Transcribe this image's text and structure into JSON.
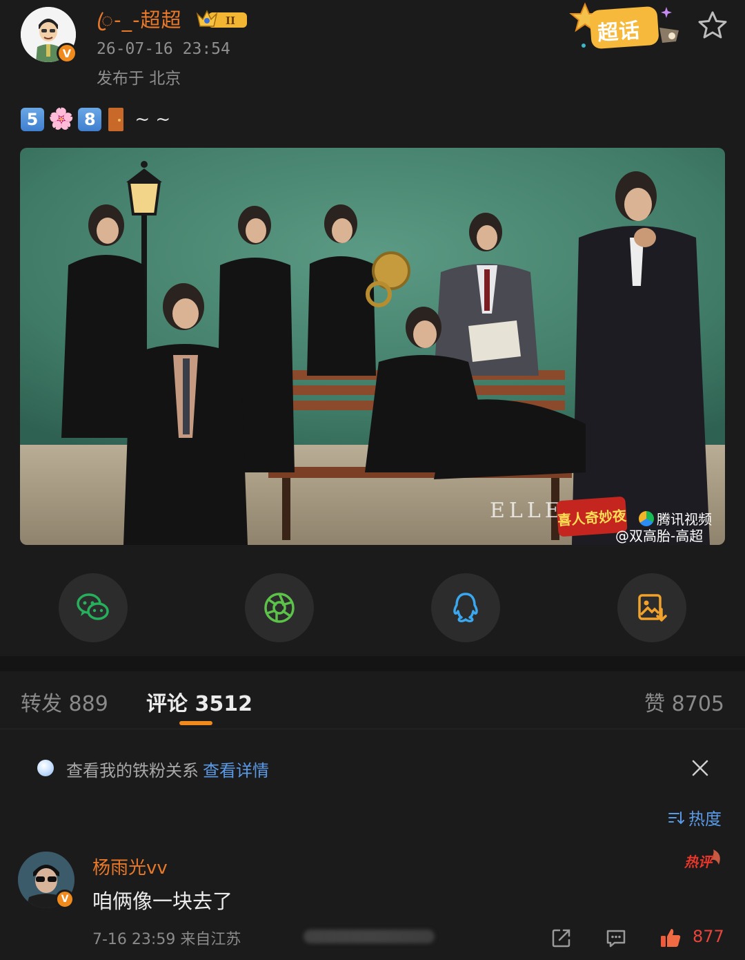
{
  "post": {
    "username": "ꦿ-_-超超",
    "timestamp": "26-07-16 23:54",
    "location": "发布于 北京",
    "level_badge": "II",
    "supertopic_label": "超话",
    "text_keycap_1": "5",
    "text_keycap_2": "8",
    "text_suffix": "~ ~",
    "photo_watermark_magazine": "ELLE",
    "photo_watermark_show": "喜人奇妙夜",
    "photo_watermark_platform": "腾讯视频",
    "photo_watermark_credit": "@双高胎-高超"
  },
  "share": {
    "items": [
      {
        "icon": "wechat-icon"
      },
      {
        "icon": "moments-icon"
      },
      {
        "icon": "qq-icon"
      },
      {
        "icon": "save-image-icon"
      }
    ]
  },
  "tabs": {
    "repost": "转发 889",
    "comment": "评论 3512",
    "like": "赞 8705"
  },
  "fan_banner": {
    "text": "查看我的铁粉关系",
    "link": "查看详情"
  },
  "sort": {
    "label": "热度"
  },
  "comment": {
    "author": "杨雨光vv",
    "hot_badge": "热评",
    "body": "咱俩像一块去了",
    "meta": "7-16 23:59 来自江苏",
    "like_count": "877"
  },
  "colors": {
    "background": "#1b1b1b",
    "username_orange": "#e8792b",
    "accent_orange": "#f08a1c",
    "link_blue": "#5b9ae6",
    "like_red": "#e8453b"
  }
}
